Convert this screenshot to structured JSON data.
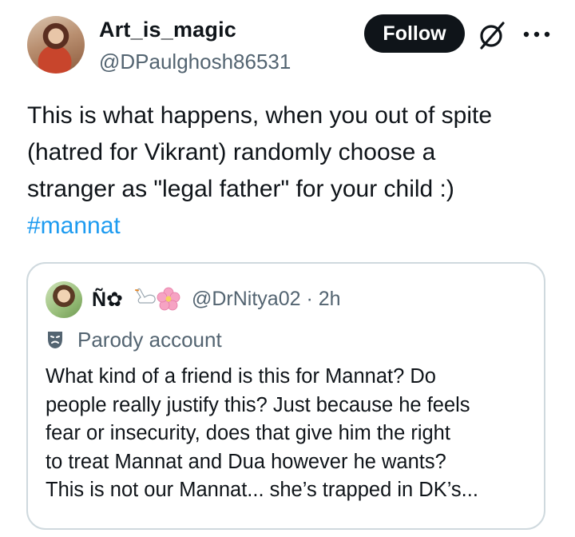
{
  "author": {
    "display_name": "Art_is_magic",
    "handle": "@DPaulghosh86531"
  },
  "actions": {
    "follow_label": "Follow",
    "grok_icon": "grok-icon",
    "more_icon": "more-icon"
  },
  "tweet": {
    "lines": [
      "This is what happens, when you out of spite",
      "(hatred for Vikrant) randomly choose a",
      "stranger as \"legal father\" for your child :)"
    ],
    "hashtag": "#mannat"
  },
  "quoted_tweet": {
    "display_name": "Ñ✿",
    "handle_time": "@DrNitya02 · 2h",
    "parody_label": "Parody account",
    "lines": [
      "What kind of a friend is this for Mannat? Do",
      "people really justify this? Just because he feels",
      "fear or insecurity, does that give him the right",
      "to treat Mannat and Dua however he wants?",
      "This is not our Mannat... she’s trapped in DK’s..."
    ]
  },
  "colors": {
    "text": "#0f1419",
    "secondary": "#536471",
    "link": "#1d9bf0",
    "border": "#cfd9de",
    "button": "#0f1419"
  }
}
